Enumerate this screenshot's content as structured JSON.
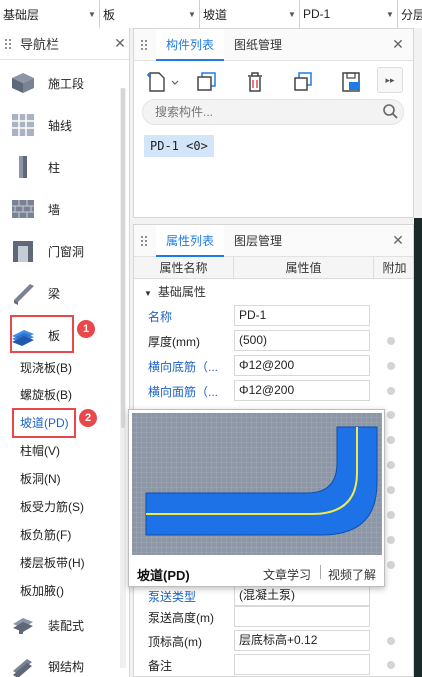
{
  "topbar": {
    "dropdowns": [
      {
        "value": "基础层",
        "name": "floor-select"
      },
      {
        "value": "板",
        "name": "category-select"
      },
      {
        "value": "坡道",
        "name": "type-select"
      },
      {
        "value": "PD-1",
        "name": "component-select"
      },
      {
        "value": "分层",
        "name": "layer-select"
      }
    ]
  },
  "nav": {
    "title": "导航栏",
    "big_items": [
      {
        "label": "施工段",
        "icon": "construction-segment-icon"
      },
      {
        "label": "轴线",
        "icon": "grid-axis-icon"
      },
      {
        "label": "柱",
        "icon": "column-icon"
      },
      {
        "label": "墙",
        "icon": "wall-icon"
      },
      {
        "label": "门窗洞",
        "icon": "door-window-icon"
      },
      {
        "label": "梁",
        "icon": "beam-icon"
      },
      {
        "label": "板",
        "icon": "slab-icon"
      }
    ],
    "sub_items": [
      "现浇板(B)",
      "螺旋板(B)",
      "坡道(PD)",
      "柱帽(V)",
      "板洞(N)",
      "板受力筋(S)",
      "板负筋(F)",
      "楼层板带(H)",
      "板加腋()"
    ],
    "bottom_items": [
      {
        "label": "装配式",
        "icon": "prefab-icon"
      },
      {
        "label": "钢结构",
        "icon": "steel-structure-icon"
      }
    ],
    "badges": [
      "1",
      "2"
    ]
  },
  "component_panel": {
    "tabs": [
      "构件列表",
      "图纸管理"
    ],
    "search_placeholder": "搜索构件...",
    "items": [
      "PD-1 <0>"
    ]
  },
  "property_panel": {
    "tabs": [
      "属性列表",
      "图层管理"
    ],
    "columns": [
      "属性名称",
      "属性值",
      "附加"
    ],
    "group": "基础属性",
    "rows": [
      {
        "name": "名称",
        "value": "PD-1"
      },
      {
        "name": "厚度(mm)",
        "value": "(500)"
      },
      {
        "name": "横向底筋（...",
        "value": "Φ12@200"
      },
      {
        "name": "横向面筋（...",
        "value": "Φ12@200"
      },
      {
        "name": "泵送类型",
        "value": "(混凝土泵)"
      },
      {
        "name": "泵送高度(m)",
        "value": ""
      },
      {
        "name": "顶标高(m)",
        "value": "层底标高+0.12"
      },
      {
        "name": "备注",
        "value": ""
      }
    ]
  },
  "popup": {
    "title": "坡道(PD)",
    "link1": "文章学习",
    "link2": "视频了解"
  },
  "colors": {
    "accent": "#1e7be6",
    "badge": "#e8474c",
    "selected_item": "#d3e5f9",
    "ramp_fill": "#1d72e8",
    "ramp_line": "#f2e84a"
  }
}
